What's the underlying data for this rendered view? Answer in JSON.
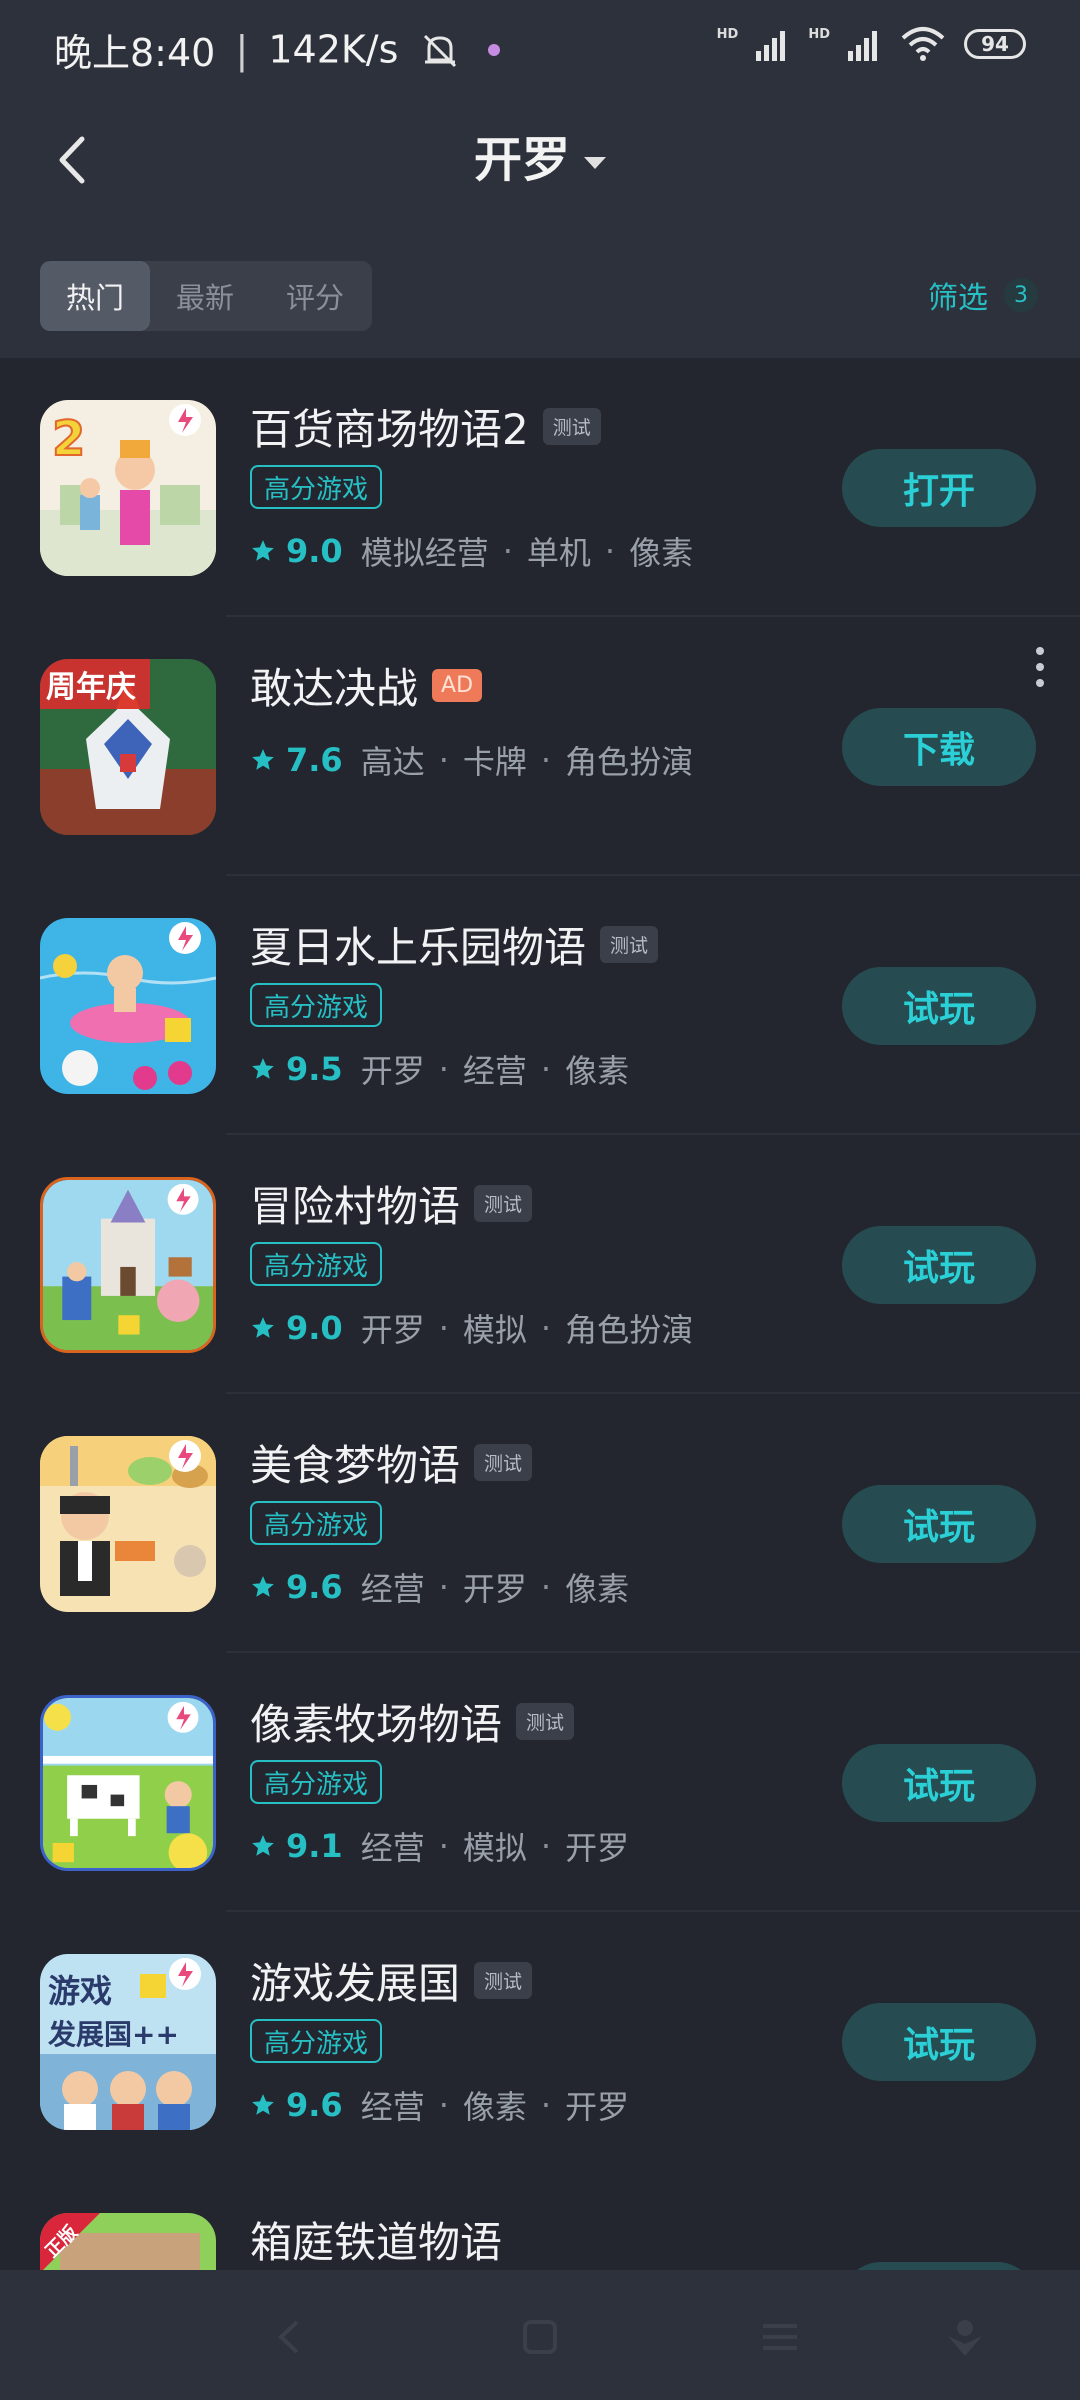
{
  "status_bar": {
    "time": "晚上8:40",
    "speed": "142K/s",
    "battery": "94"
  },
  "header": {
    "title": "开罗"
  },
  "tabs": [
    "热门",
    "最新",
    "评分"
  ],
  "filter": {
    "label": "筛选",
    "count": "3"
  },
  "colors": {
    "accent": "#26bfc4",
    "background": "#23262f",
    "button_bg": "#264c52",
    "ad": "#ee7a59"
  },
  "games": [
    {
      "name": "百货商场物语2",
      "badge": "测试",
      "high_score": "高分游戏",
      "score": "9.0",
      "tags": [
        "模拟经营",
        "单机",
        "像素"
      ],
      "action": "打开"
    },
    {
      "name": "敢达决战",
      "badge": "AD",
      "score": "7.6",
      "tags": [
        "高达",
        "卡牌",
        "角色扮演"
      ],
      "action": "下载"
    },
    {
      "name": "夏日水上乐园物语",
      "badge": "测试",
      "high_score": "高分游戏",
      "score": "9.5",
      "tags": [
        "开罗",
        "经营",
        "像素"
      ],
      "action": "试玩"
    },
    {
      "name": "冒险村物语",
      "badge": "测试",
      "high_score": "高分游戏",
      "score": "9.0",
      "tags": [
        "开罗",
        "模拟",
        "角色扮演"
      ],
      "action": "试玩"
    },
    {
      "name": "美食梦物语",
      "badge": "测试",
      "high_score": "高分游戏",
      "score": "9.6",
      "tags": [
        "经营",
        "开罗",
        "像素"
      ],
      "action": "试玩"
    },
    {
      "name": "像素牧场物语",
      "badge": "测试",
      "high_score": "高分游戏",
      "score": "9.1",
      "tags": [
        "经营",
        "模拟",
        "开罗"
      ],
      "action": "试玩"
    },
    {
      "name": "游戏发展国",
      "badge": "测试",
      "high_score": "高分游戏",
      "score": "9.6",
      "tags": [
        "经营",
        "像素",
        "开罗"
      ],
      "action": "试玩"
    },
    {
      "name": "箱庭铁道物语",
      "icon_label": "正版"
    }
  ],
  "icon_art": {
    "game0_text": "2",
    "game1_text": "周年庆",
    "game6_text_1": "游戏",
    "game6_text_2": "发展国++"
  }
}
